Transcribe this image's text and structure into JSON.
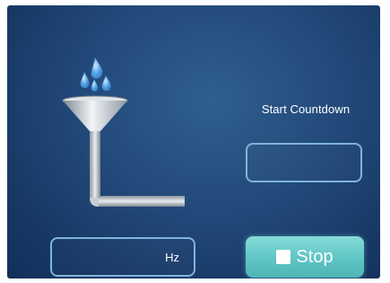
{
  "countdown": {
    "label": "Start Countdown",
    "value": ""
  },
  "frequency": {
    "value": "",
    "unit": "Hz"
  },
  "stop_button": {
    "label": "Stop"
  },
  "icons": {
    "funnel": "funnel-with-water-drops-icon",
    "stop": "stop-square-icon"
  },
  "colors": {
    "background": "#22497a",
    "field_border": "#7fb4da",
    "button": "#5fc4c4",
    "text": "#ffffff"
  }
}
